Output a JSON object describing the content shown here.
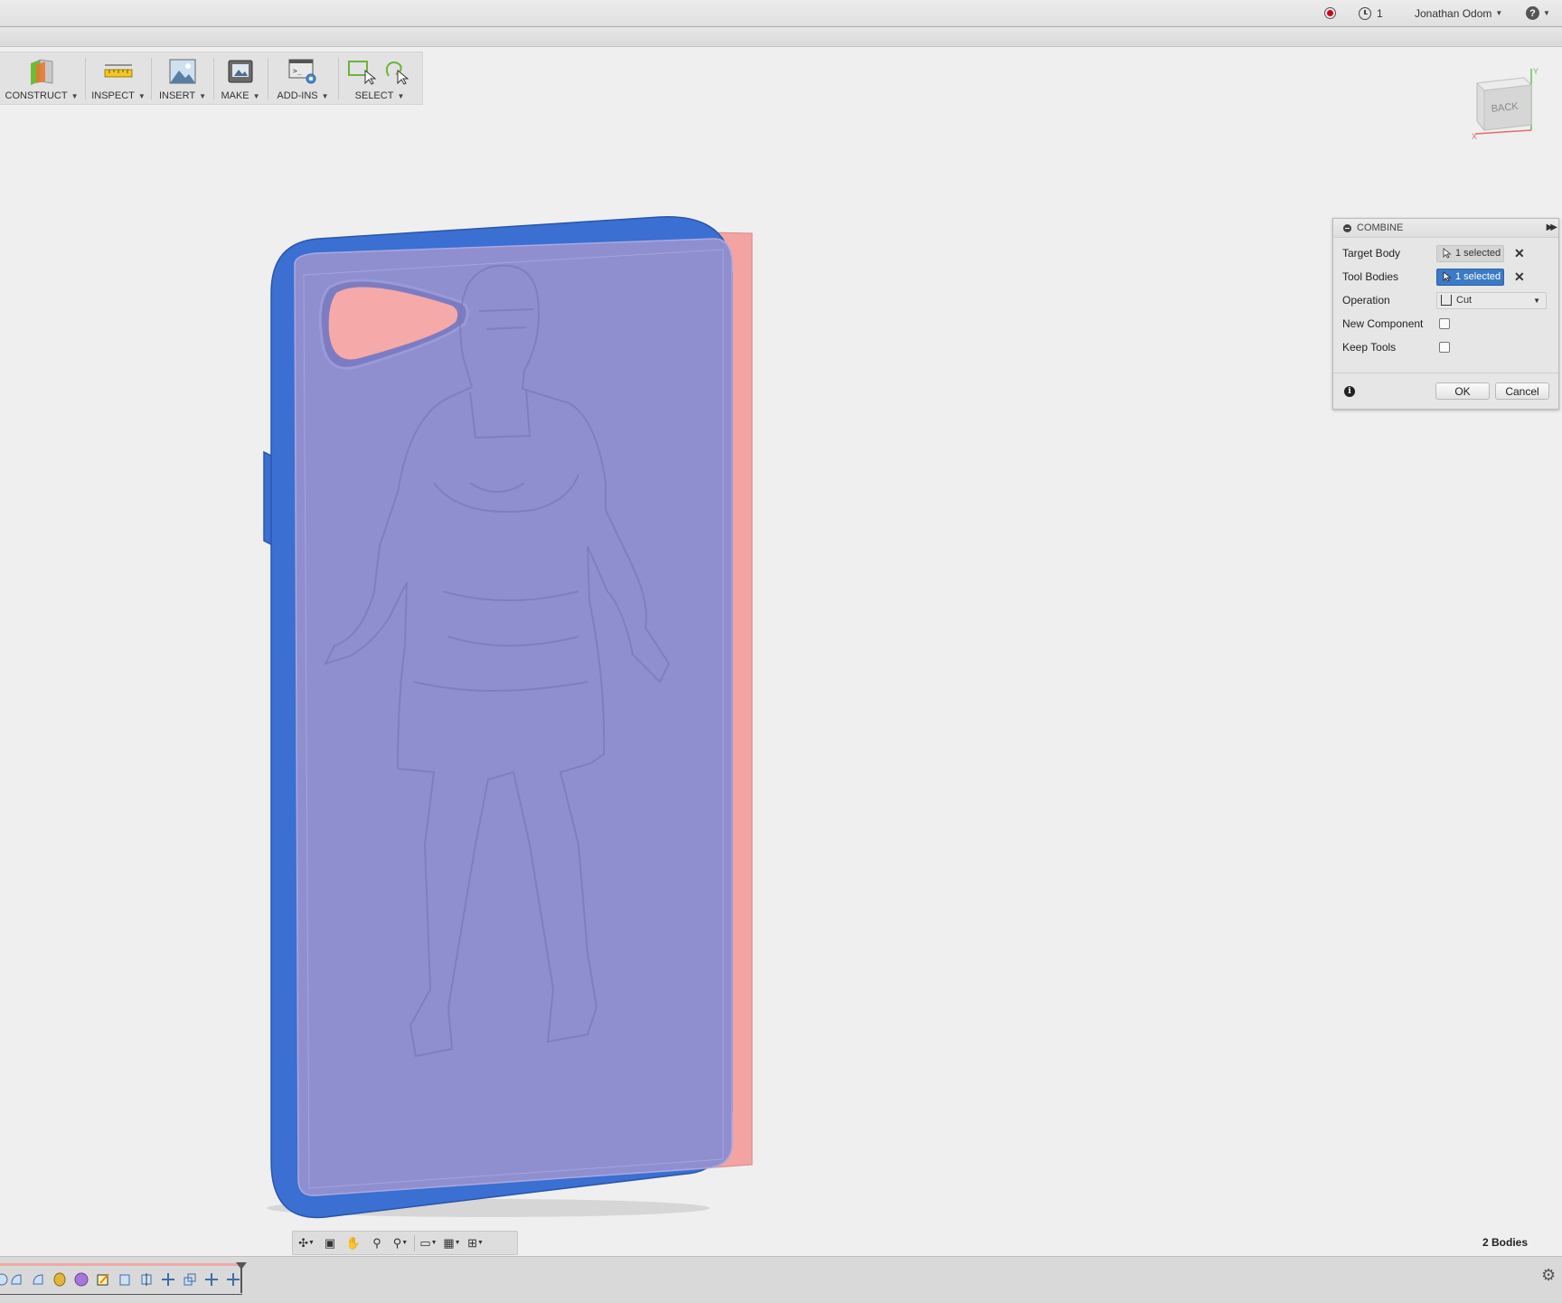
{
  "topbar": {
    "record_icon": "record-icon",
    "jobs_icon": "clock-icon",
    "jobs_count": "1",
    "user_name": "Jonathan Odom",
    "help_icon": "help-icon",
    "help_glyph": "?"
  },
  "toolbar": {
    "items": [
      {
        "label": "CONSTRUCT",
        "icon": "construct-plane-icon"
      },
      {
        "label": "INSPECT",
        "icon": "ruler-icon"
      },
      {
        "label": "INSERT",
        "icon": "image-icon"
      },
      {
        "label": "MAKE",
        "icon": "printer-icon"
      },
      {
        "label": "ADD-INS",
        "icon": "script-gear-icon"
      },
      {
        "label": "SELECT",
        "icon": "select-cursor-icon"
      }
    ]
  },
  "viewcube": {
    "face_label": "BACK",
    "axis_x": "X",
    "axis_y": "Y"
  },
  "combine": {
    "title": "COMBINE",
    "target_body_label": "Target Body",
    "target_body_value": "1 selected",
    "tool_bodies_label": "Tool Bodies",
    "tool_bodies_value": "1 selected",
    "operation_label": "Operation",
    "operation_value": "Cut",
    "new_component_label": "New Component",
    "new_component_checked": false,
    "keep_tools_label": "Keep Tools",
    "keep_tools_checked": false,
    "ok_label": "OK",
    "cancel_label": "Cancel",
    "info_glyph": "i",
    "clear_glyph": "✕"
  },
  "status": {
    "bodies_count": "2 Bodies"
  },
  "colors": {
    "target_body": "#3b6fd1",
    "tool_body": "#8f8fd0",
    "cutout": "#f5a9a9",
    "selection_highlight": "#3c7ac6"
  }
}
